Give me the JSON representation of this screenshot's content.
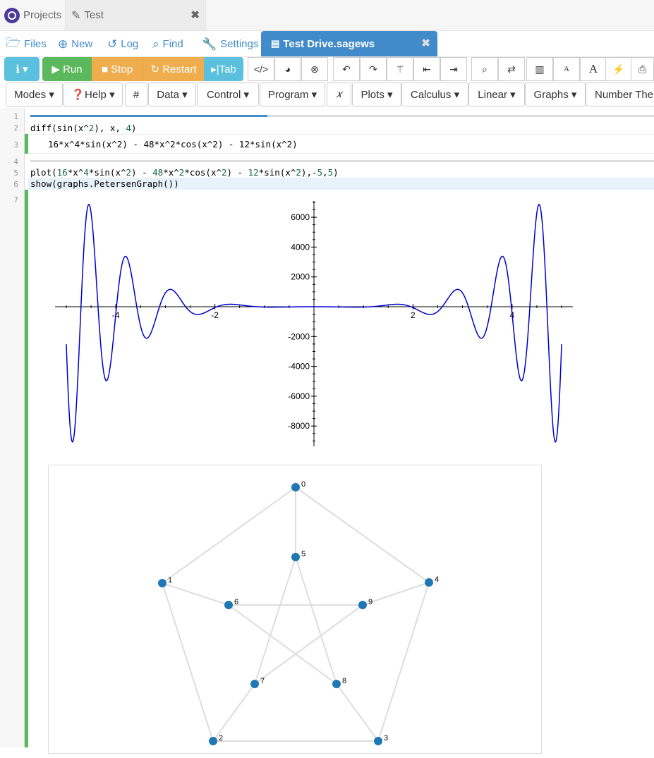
{
  "tabs": {
    "projects_label": "Projects",
    "test_label": "Test",
    "close_glyph": "✖"
  },
  "nav": {
    "files": "Files",
    "new": "New",
    "log": "Log",
    "find": "Find",
    "settings": "Settings",
    "active_file": "Test Drive.sagews",
    "close_glyph": "✖"
  },
  "toolbar": {
    "info": "ℹ ▾",
    "run": "▶ Run",
    "stop": "■ Stop",
    "restart": "↻ Restart",
    "tab": "▸|Tab",
    "icons": [
      "code-icon",
      "chart-pie-icon",
      "close-circle-icon",
      "undo-icon",
      "redo-icon",
      "magic-wand-icon",
      "outdent-icon",
      "indent-icon",
      "search-icon",
      "swap-icon",
      "columns-icon",
      "font-small-icon",
      "font-large-icon",
      "bolt-icon",
      "print-icon"
    ]
  },
  "menus": [
    "Modes ▾",
    "❓Help ▾",
    "#",
    "Data ▾",
    "Control ▾",
    "Program ▾",
    "𝑥",
    "Plots ▾",
    "Calculus ▾",
    "Linear ▾",
    "Graphs ▾",
    "Number The"
  ],
  "editor": {
    "line_numbers": [
      "1",
      "2",
      "3",
      "4",
      "5",
      "6",
      "7"
    ],
    "line2": "diff(sin(x^2), x, 4)",
    "output3": "16*x^4*sin(x^2) - 48*x^2*cos(x^2) - 12*sin(x^2)",
    "line5": "plot(16*x^4*sin(x^2) - 48*x^2*cos(x^2) - 12*sin(x^2),-5,5)",
    "line6": "show(graphs.PetersenGraph())"
  },
  "chart_data": [
    {
      "type": "line",
      "title": "",
      "xlabel": "",
      "ylabel": "",
      "xlim": [
        -5,
        5
      ],
      "ylim": [
        -9300,
        7100
      ],
      "xticks": [
        "-4",
        "-2",
        "2",
        "4"
      ],
      "yticks": [
        "6000",
        "4000",
        "2000",
        "-2000",
        "-4000",
        "-6000",
        "-8000"
      ],
      "series": [
        {
          "function": "16*x^4*sin(x^2) - 48*x^2*cos(x^2) - 12*sin(x^2)",
          "color": "#0000cc"
        }
      ]
    },
    {
      "type": "graph",
      "nodes": [
        "0",
        "1",
        "2",
        "3",
        "4",
        "5",
        "6",
        "7",
        "8",
        "9"
      ],
      "edges": [
        [
          0,
          1
        ],
        [
          1,
          2
        ],
        [
          2,
          3
        ],
        [
          3,
          4
        ],
        [
          4,
          0
        ],
        [
          0,
          5
        ],
        [
          1,
          6
        ],
        [
          2,
          7
        ],
        [
          3,
          8
        ],
        [
          4,
          9
        ],
        [
          5,
          7
        ],
        [
          7,
          9
        ],
        [
          9,
          6
        ],
        [
          6,
          8
        ],
        [
          8,
          5
        ]
      ],
      "node_color": "#1f77b4",
      "edge_color": "#dddddd"
    }
  ]
}
